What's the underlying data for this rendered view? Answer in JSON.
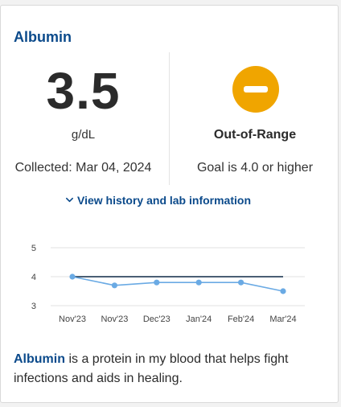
{
  "card": {
    "title": "Albumin",
    "value": "3.5",
    "unit": "g/dL",
    "collected": "Collected: Mar 04, 2024",
    "status": "Out-of-Range",
    "status_icon": "minus-circle-icon",
    "status_color": "#f0a500",
    "goal": "Goal is 4.0 or higher",
    "history_link": "View history and lab information",
    "description_term": "Albumin",
    "description_rest": " is a protein in my blood that helps fight infections and aids in healing."
  },
  "colors": {
    "accent": "#0b4a8b",
    "series": "#6aaae4",
    "goal_line": "#0e2a47"
  },
  "chart_data": {
    "type": "line",
    "categories": [
      "Nov'23",
      "Nov'23",
      "Dec'23",
      "Jan'24",
      "Feb'24",
      "Mar'24"
    ],
    "series": [
      {
        "values": [
          4.0,
          3.7,
          3.8,
          3.8,
          3.8,
          3.5
        ]
      }
    ],
    "reference_line": 4.0,
    "yticks": [
      3,
      4,
      5
    ],
    "ylim": [
      3,
      5
    ],
    "grid": true
  }
}
